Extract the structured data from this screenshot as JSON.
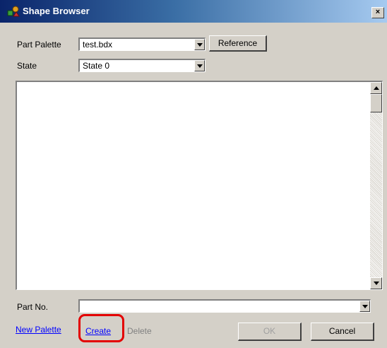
{
  "window": {
    "title": "Shape Browser",
    "close_glyph": "×",
    "title_icon": "shapes-app-icon"
  },
  "form": {
    "part_palette_label": "Part Palette",
    "part_palette_value": "test.bdx",
    "reference_button": "Reference",
    "state_label": "State",
    "state_value": "State 0",
    "part_no_label": "Part No.",
    "part_no_value": ""
  },
  "footer": {
    "new_palette_link": "New Palette",
    "create_link": "Create",
    "delete_link": "Delete",
    "ok_button": "OK",
    "cancel_button": "Cancel"
  },
  "colors": {
    "titlebar_start": "#0a246a",
    "titlebar_end": "#a6caf0",
    "dialog_face": "#d4d0c8",
    "link": "#0000ff",
    "annotation": "#e30000"
  }
}
